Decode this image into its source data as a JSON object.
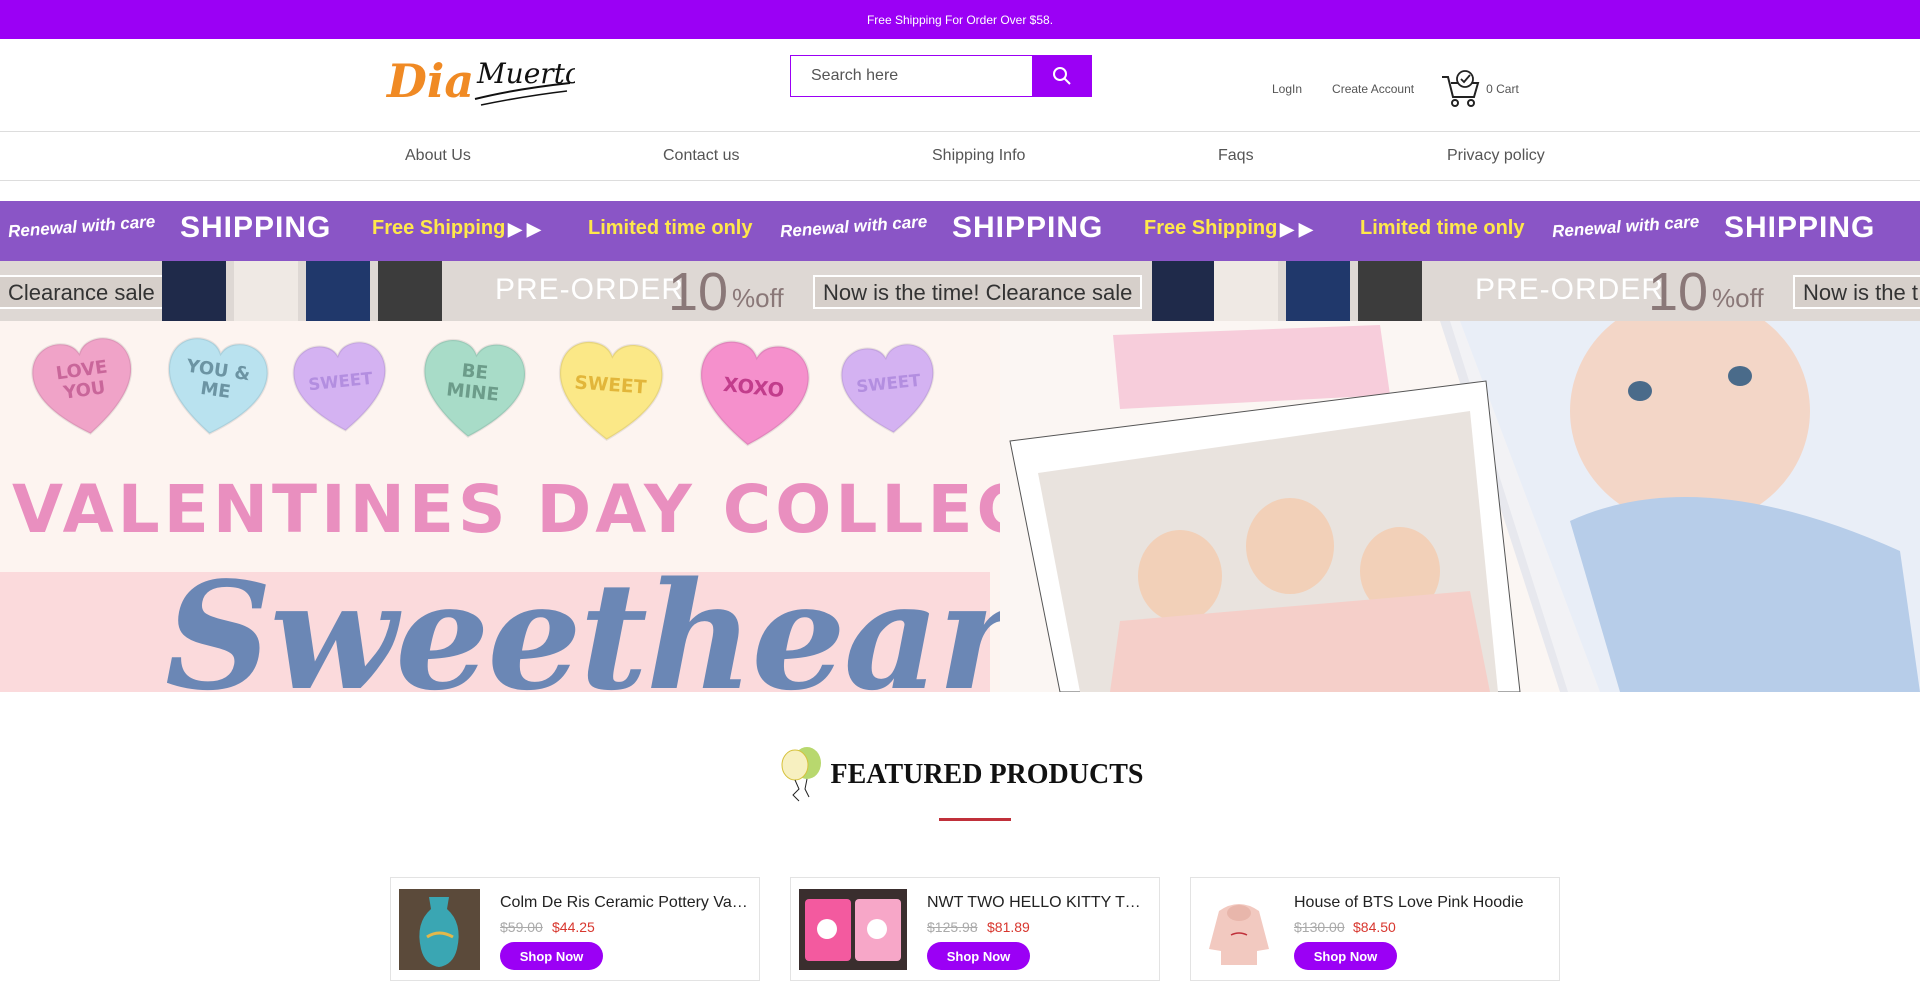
{
  "promo": {
    "text": "Free Shipping For Order Over $58."
  },
  "header": {
    "logo_text": "Dia Muertos",
    "search": {
      "placeholder": "Search here",
      "value": ""
    },
    "login_label": "LogIn",
    "create_account_label": "Create Account",
    "cart_label": "0 Cart"
  },
  "nav": {
    "items": [
      {
        "label": "About Us"
      },
      {
        "label": "Contact us"
      },
      {
        "label": "Shipping Info"
      },
      {
        "label": "Faqs"
      },
      {
        "label": "Privacy policy"
      }
    ]
  },
  "ribbon1": {
    "renewal": "Renewal with care",
    "shipping": "SHIPPING",
    "free_shipping": "Free Shipping",
    "limited": "Limited time only"
  },
  "ribbon2": {
    "clearance": "Clearance sale",
    "preorder": "PRE-ORDER",
    "num": "10",
    "off": "%off",
    "now": "Now is the time! Clearance sale",
    "now_partial": "Now is the t"
  },
  "hero": {
    "title": "VALENTINES DAY COLLECTION",
    "subtitle": "Sweetheart",
    "hearts": [
      {
        "l1": "LOVE",
        "l2": "YOU",
        "color": "#f0a3c8",
        "text": "#c9669a"
      },
      {
        "l1": "YOU &",
        "l2": "ME",
        "color": "#b9e2ef",
        "text": "#6c94a3"
      },
      {
        "l1": "SWEET",
        "l2": "",
        "color": "#d4b2f2",
        "text": "#b38ee0"
      },
      {
        "l1": "BE",
        "l2": "MINE",
        "color": "#a8dcc8",
        "text": "#6c9c8a"
      },
      {
        "l1": "SWEET",
        "l2": "",
        "color": "#fbe887",
        "text": "#e2b63a"
      },
      {
        "l1": "XOXO",
        "l2": "",
        "color": "#f590cc",
        "text": "#c23d8c"
      },
      {
        "l1": "SWEET",
        "l2": "",
        "color": "#d4b2f2",
        "text": "#b38ee0"
      }
    ]
  },
  "featured": {
    "title": "FEATURED PRODUCTS"
  },
  "products": [
    {
      "title": "Colm De Ris Ceramic Pottery Vase ...",
      "old_price": "$59.00",
      "new_price": "$44.25",
      "button": "Shop Now"
    },
    {
      "title": "NWT TWO HELLO KITTY TOWEL ...",
      "old_price": "$125.98",
      "new_price": "$81.89",
      "button": "Shop Now"
    },
    {
      "title": "House of BTS Love Pink Hoodie",
      "old_price": "$130.00",
      "new_price": "$84.50",
      "button": "Shop Now"
    }
  ],
  "colors": {
    "accent": "#9b00f5",
    "price_red": "#d8372f",
    "divider_red": "#c0303a"
  }
}
